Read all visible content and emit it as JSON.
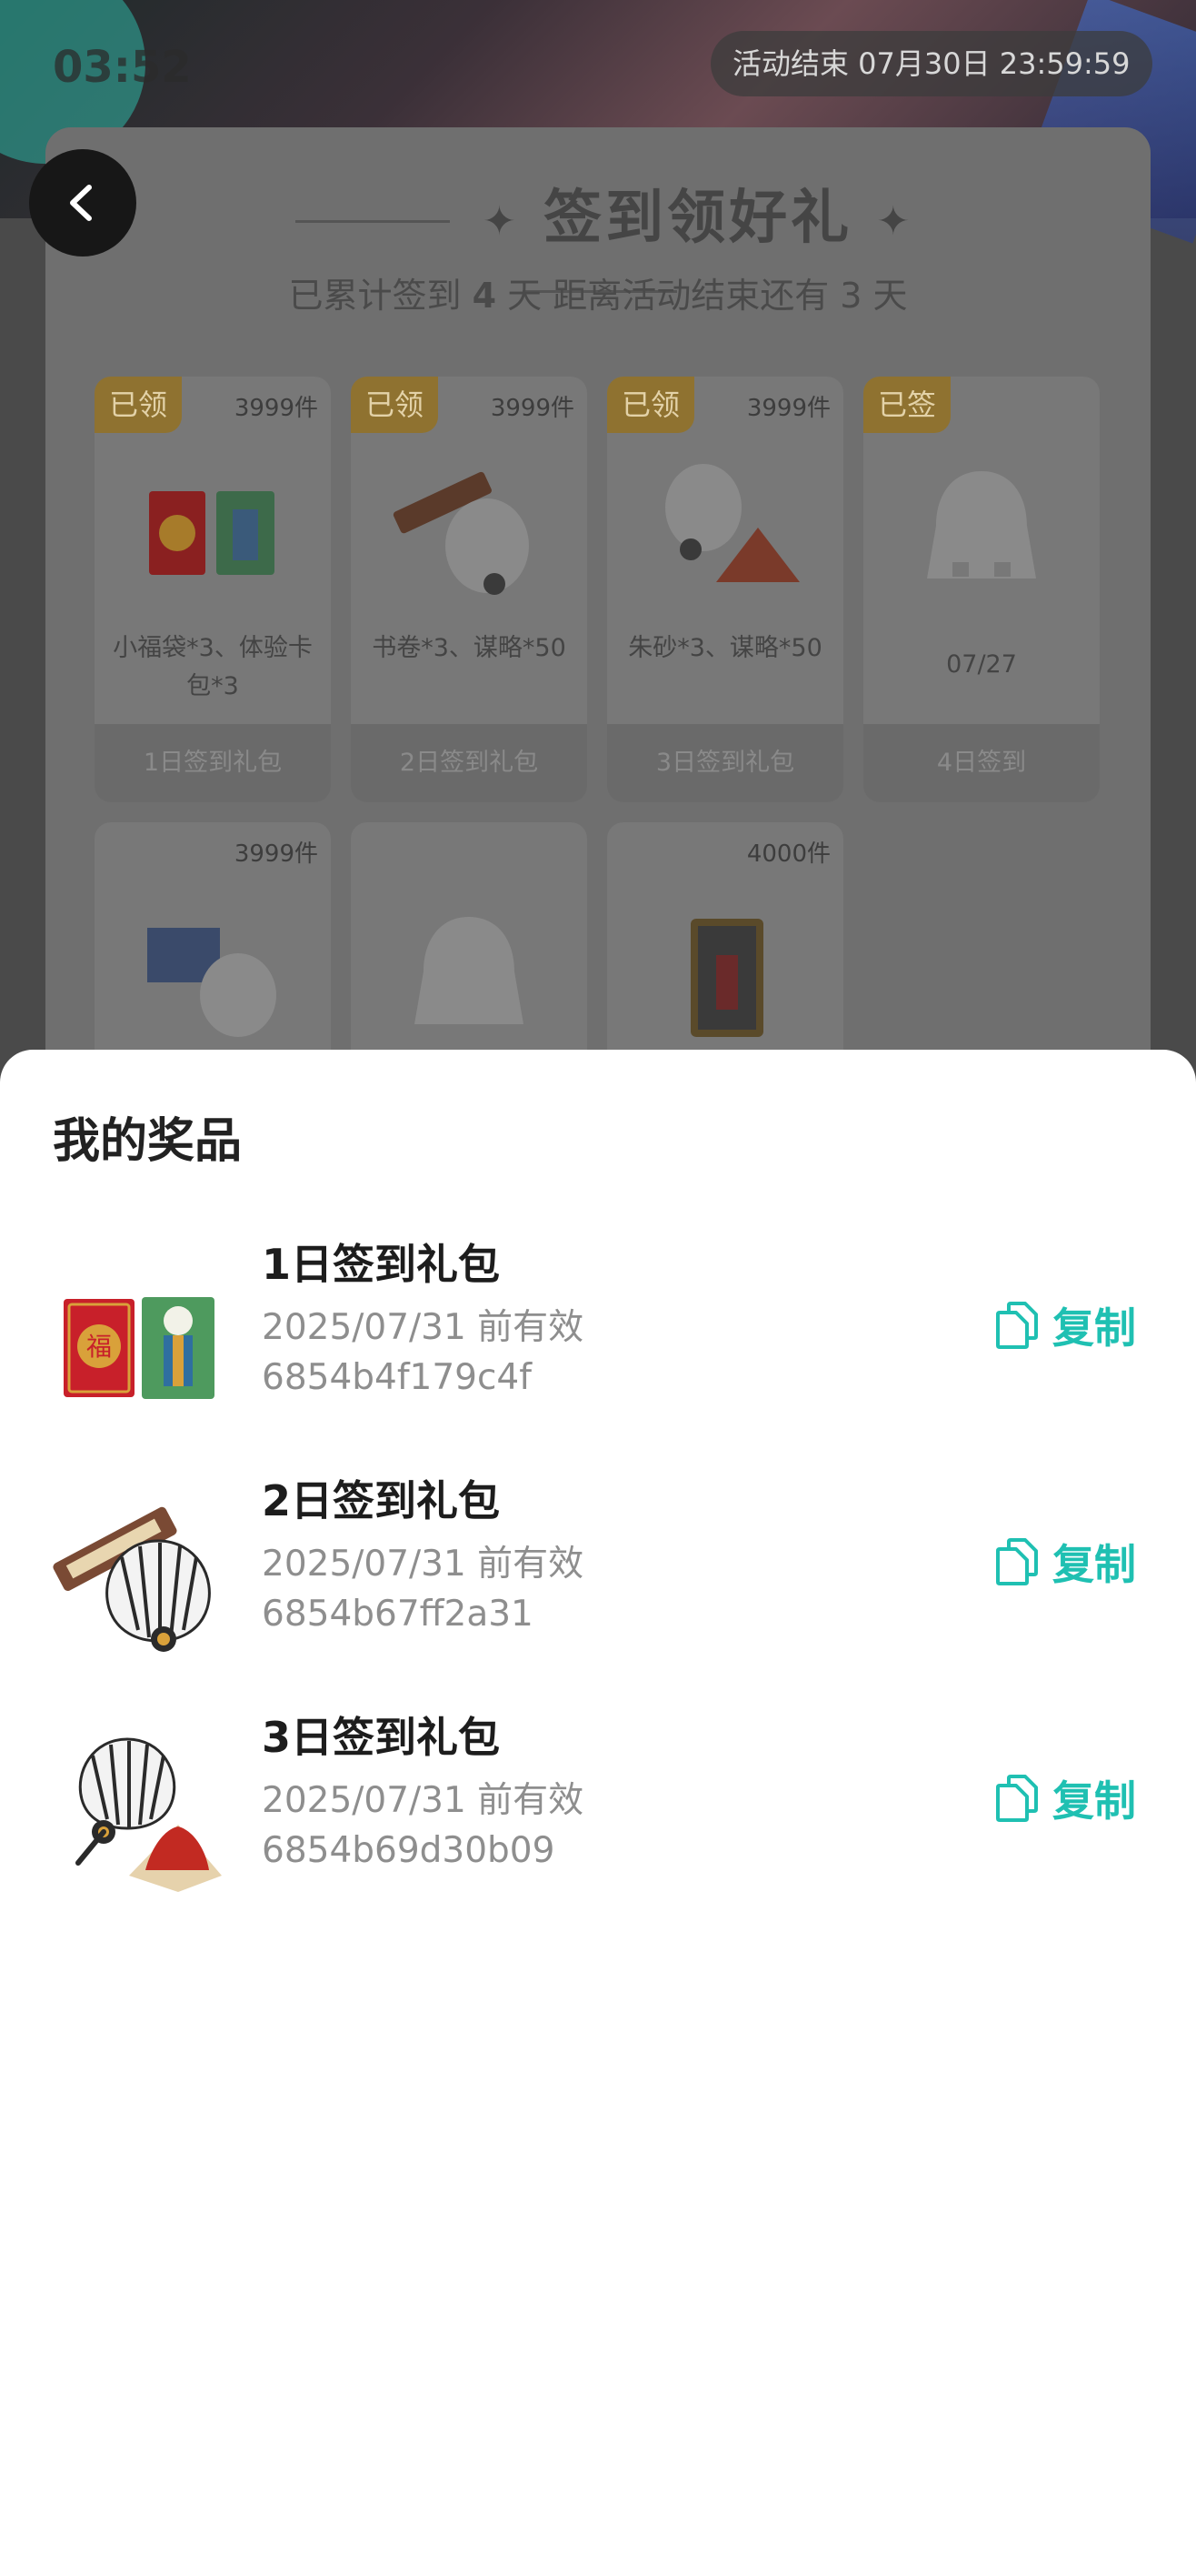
{
  "status_bar": {
    "time": "03:52"
  },
  "header": {
    "countdown": "活动结束 07月30日 23:59:59"
  },
  "card": {
    "title": "签到领好礼",
    "summary_prefix": "已累计签到",
    "signed_days": "4",
    "summary_mid": "天  距离活动结束还有 3 天"
  },
  "days": [
    {
      "badge": "已领",
      "count": "3999件",
      "desc": "小福袋*3、体验卡包*3",
      "footer": "1日签到礼包"
    },
    {
      "badge": "已领",
      "count": "3999件",
      "desc": "书卷*3、谋略*50",
      "footer": "2日签到礼包"
    },
    {
      "badge": "已领",
      "count": "3999件",
      "desc": "朱砂*3、谋略*50",
      "footer": "3日签到礼包"
    },
    {
      "badge": "已签",
      "count": "",
      "desc": "07/27",
      "footer": "4日签到"
    },
    {
      "badge": "",
      "count": "3999件",
      "desc": "",
      "footer": ""
    },
    {
      "badge": "",
      "count": "",
      "desc": "",
      "footer": ""
    },
    {
      "badge": "",
      "count": "4000件",
      "desc": "",
      "footer": ""
    }
  ],
  "sheet": {
    "title": "我的奖品",
    "copy_label": "复制",
    "accent_color": "#1fc0b2",
    "prizes": [
      {
        "name": "1日签到礼包",
        "valid": "2025/07/31 前有效",
        "code": "6854b4f179c4f"
      },
      {
        "name": "2日签到礼包",
        "valid": "2025/07/31 前有效",
        "code": "6854b67ff2a31"
      },
      {
        "name": "3日签到礼包",
        "valid": "2025/07/31 前有效",
        "code": "6854b69d30b09"
      }
    ]
  }
}
